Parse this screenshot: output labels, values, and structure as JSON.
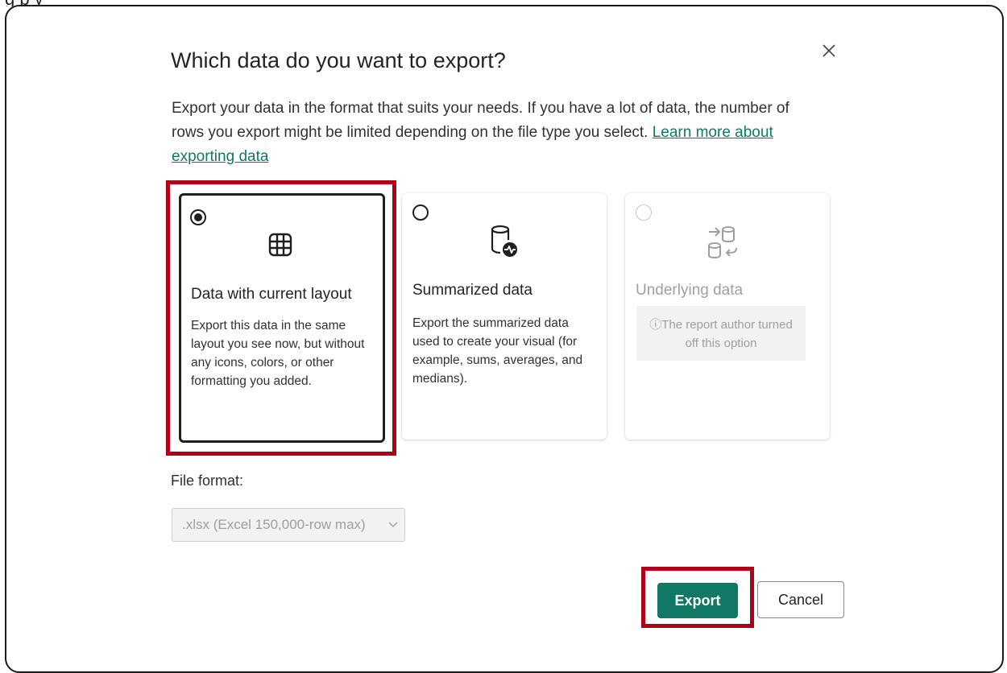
{
  "dialog": {
    "title": "Which data do you want to export?",
    "description": "Export your data in the format that suits your needs. If you have a lot of data, the number of rows you export might be limited depending on the file type you select.",
    "learn_more_link": "Learn more about exporting data"
  },
  "options": [
    {
      "title": "Data with current layout",
      "description": "Export this data in the same layout you see now, but without any icons, colors, or other formatting you added.",
      "icon": "table-icon",
      "selected": true,
      "disabled": false
    },
    {
      "title": "Summarized data",
      "description": "Export the summarized data used to create your visual (for example, sums, averages, and medians).",
      "icon": "database-activity-icon",
      "selected": false,
      "disabled": false
    },
    {
      "title": "Underlying data",
      "notice": "The report author turned off this option",
      "icon": "database-sync-icon",
      "selected": false,
      "disabled": true
    }
  ],
  "file_format": {
    "label": "File format:",
    "selected": ".xlsx (Excel 150,000-row max)"
  },
  "buttons": {
    "export": "Export",
    "cancel": "Cancel"
  },
  "colors": {
    "accent": "#117865",
    "highlight": "#b00018",
    "disabled_text": "#a19f9d"
  }
}
